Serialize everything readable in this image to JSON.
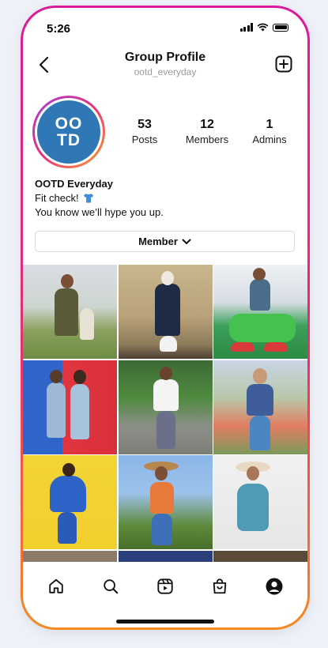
{
  "status_bar": {
    "time": "5:26"
  },
  "header": {
    "title": "Group Profile",
    "subtitle": "ootd_everyday"
  },
  "avatar": {
    "line1": "OO",
    "line2": "TD",
    "color": "#2f78b5"
  },
  "stats": [
    {
      "value": "53",
      "label": "Posts"
    },
    {
      "value": "12",
      "label": "Members"
    },
    {
      "value": "1",
      "label": "Admins"
    }
  ],
  "bio": {
    "name": "OOTD Everyday",
    "line1": "Fit check!",
    "line2": "You know we’ll hype you up."
  },
  "member_button": {
    "label": "Member"
  },
  "grid_photos": [
    "outfit-photo-1",
    "outfit-photo-2",
    "outfit-photo-3",
    "outfit-photo-4",
    "outfit-photo-5",
    "outfit-photo-6",
    "outfit-photo-7",
    "outfit-photo-8",
    "outfit-photo-9",
    "outfit-photo-10",
    "outfit-photo-11",
    "outfit-photo-12"
  ],
  "tabs": [
    "home-icon",
    "search-icon",
    "reels-icon",
    "shop-icon",
    "profile-icon"
  ],
  "colors": {
    "accent_start": "#d81b9b",
    "accent_end": "#f58a1f",
    "avatar_bg": "#2f78b5"
  }
}
